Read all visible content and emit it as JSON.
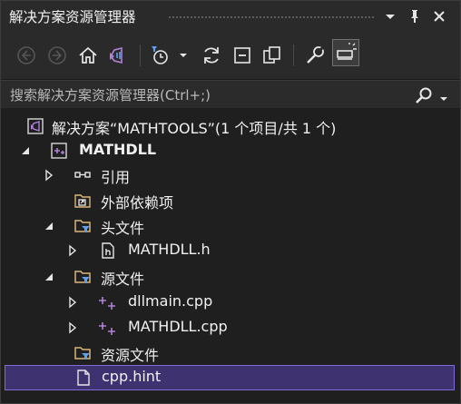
{
  "window": {
    "title": "解决方案资源管理器"
  },
  "title_buttons": [
    "chevron-down-icon",
    "pin-icon",
    "close-icon"
  ],
  "toolbar": {
    "icons": [
      "back-icon",
      "forward-icon",
      "home-icon",
      "switch-views-icon",
      "pending-changes-filter-icon",
      "sync-icon",
      "collapse-all-icon",
      "show-all-files-icon",
      "properties-icon",
      "preview-selected-icon"
    ]
  },
  "search": {
    "placeholder": "搜索解决方案资源管理器(Ctrl+;)"
  },
  "tree": {
    "solution": "解决方案“MATHTOOLS”(1 个项目/共 1 个)",
    "project": "MATHDLL",
    "references": "引用",
    "external_deps": "外部依赖项",
    "header_files": "头文件",
    "header_file_1": "MATHDLL.h",
    "source_files": "源文件",
    "source_file_1": "dllmain.cpp",
    "source_file_2": "MATHDLL.cpp",
    "resource_files": "资源文件",
    "hint_file": "cpp.hint"
  },
  "colors": {
    "accent": "#7f6ad6",
    "selection": "#3e3271",
    "folder": "#dcb67a",
    "vs_purple": "#b180d7"
  }
}
